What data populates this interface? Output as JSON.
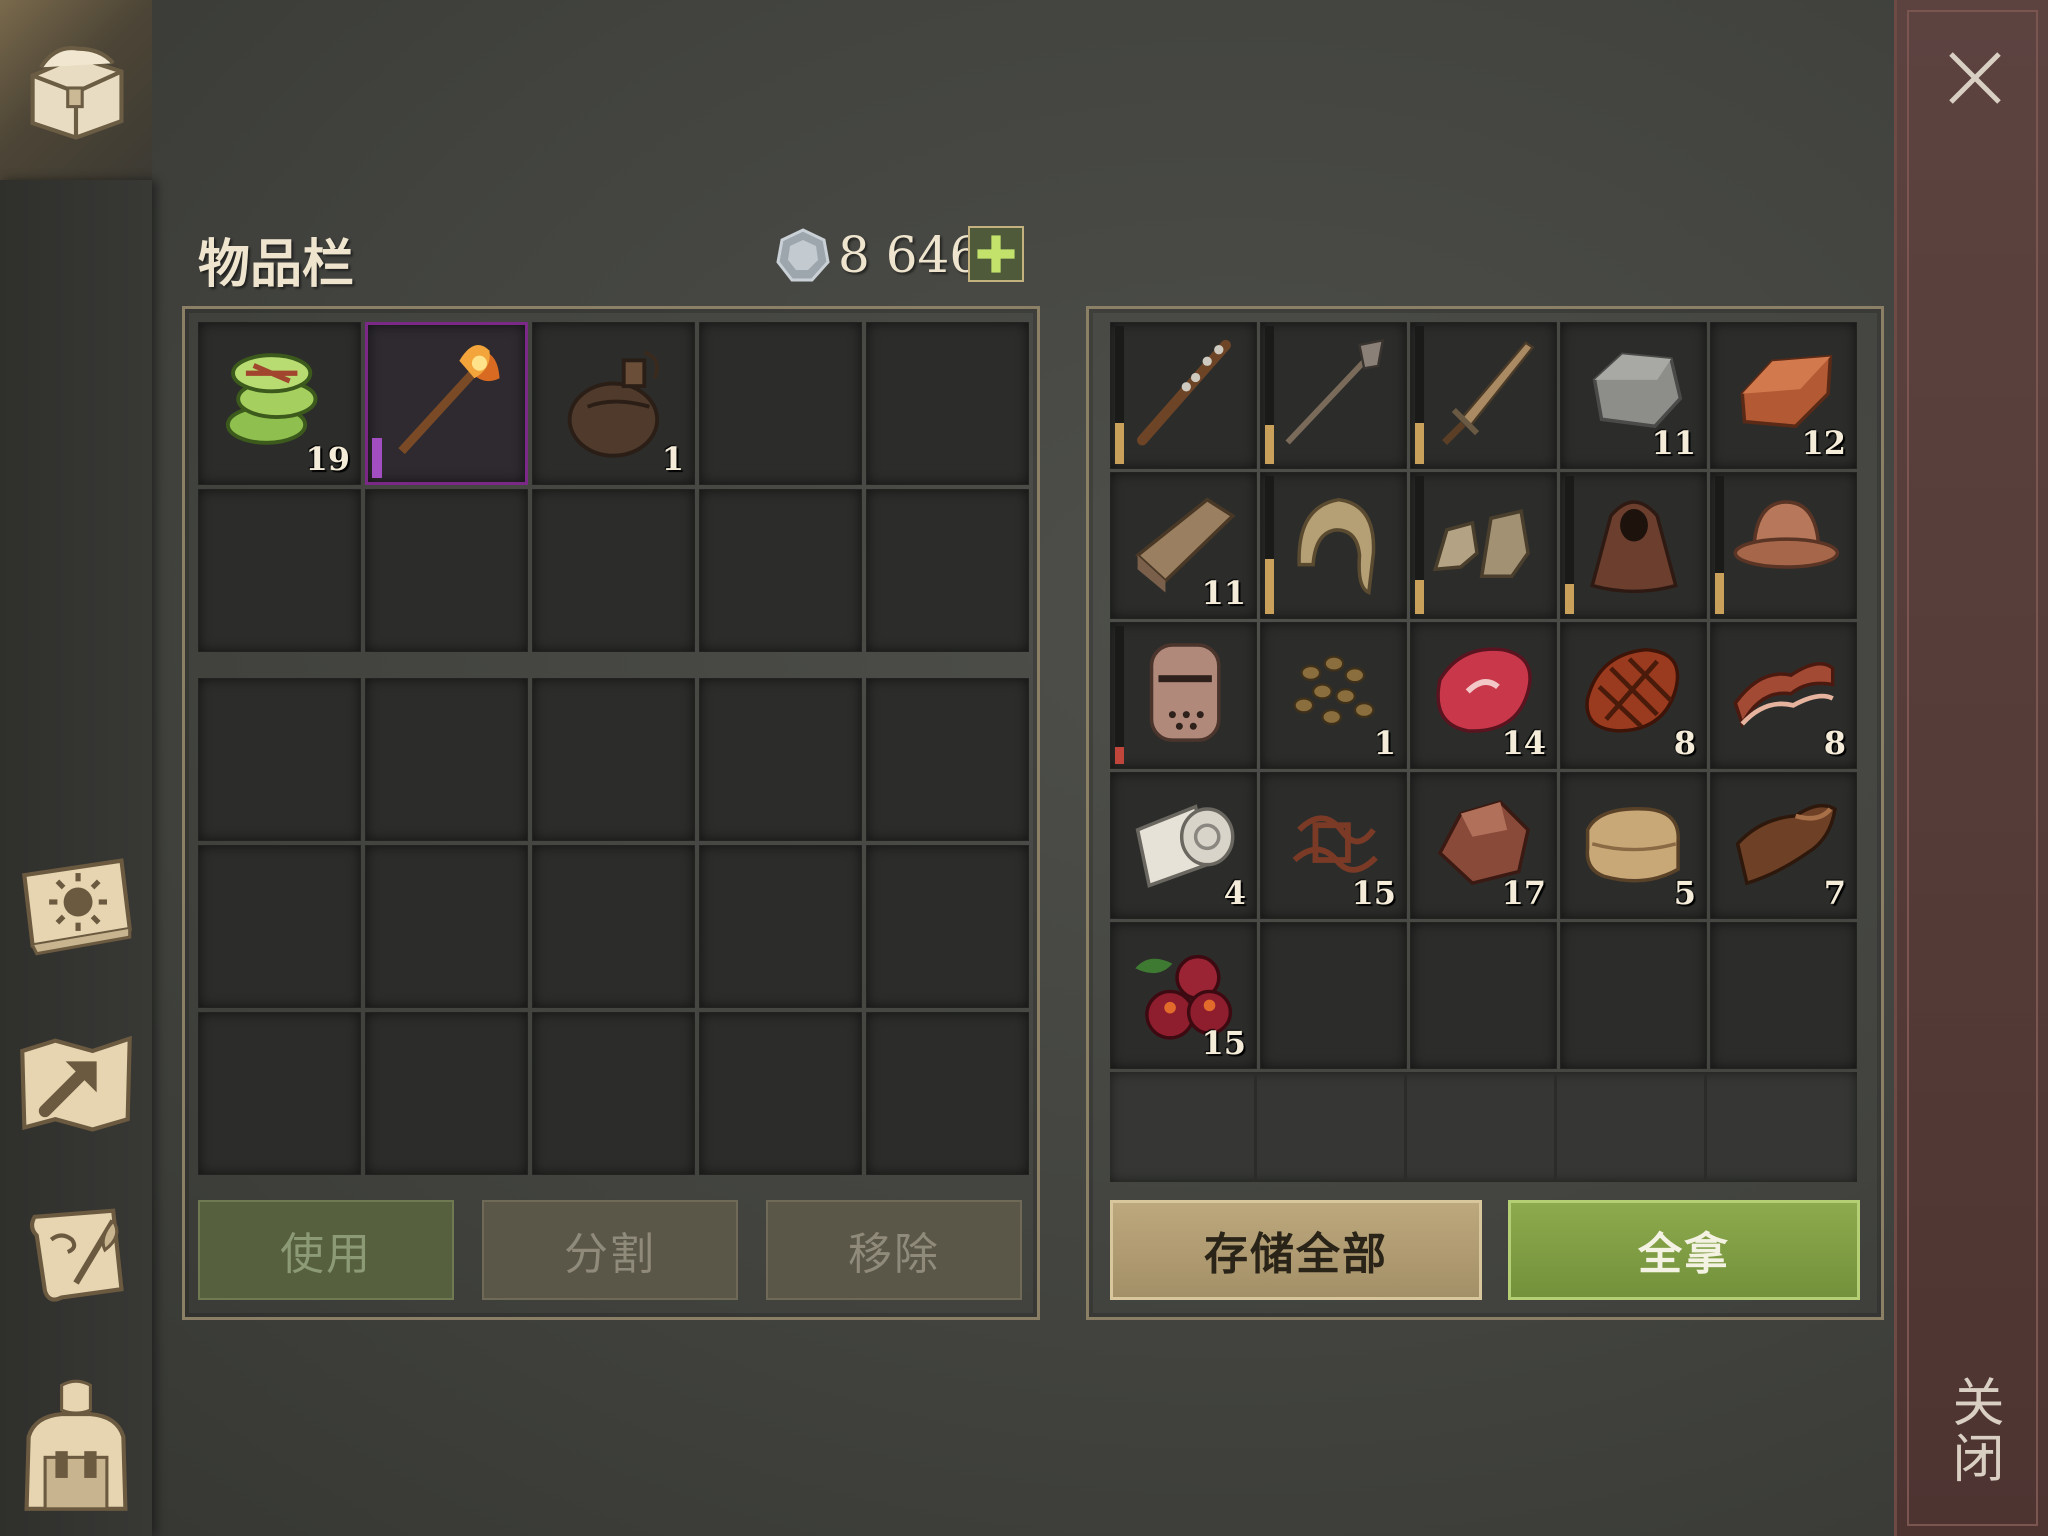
{
  "header": {
    "title": "物品栏",
    "currency": "8 646"
  },
  "sidebar": {
    "items": [
      "chest-icon",
      "daily-quest-book-icon",
      "map-icon",
      "scroll-quill-icon",
      "backpack-character-icon"
    ]
  },
  "close_panel": {
    "label": "关闭"
  },
  "inventory": {
    "slots": [
      {
        "icon": "cucumber-slices-icon",
        "count": "19"
      },
      {
        "icon": "flaming-axe-icon",
        "count": "",
        "selected": true
      },
      {
        "icon": "water-flask-icon",
        "count": "1"
      }
    ]
  },
  "container": {
    "slots": [
      {
        "icon": "spiked-club-icon",
        "count": ""
      },
      {
        "icon": "mace-spear-icon",
        "count": ""
      },
      {
        "icon": "sword-icon",
        "count": ""
      },
      {
        "icon": "stone-icon",
        "count": "11"
      },
      {
        "icon": "copper-ingot-icon",
        "count": "12"
      },
      {
        "icon": "wood-plank-icon",
        "count": "11"
      },
      {
        "icon": "hood-icon",
        "count": ""
      },
      {
        "icon": "boots-icon",
        "count": ""
      },
      {
        "icon": "cloak-hood-icon",
        "count": ""
      },
      {
        "icon": "kettle-helmet-icon",
        "count": ""
      },
      {
        "icon": "great-helm-icon",
        "count": ""
      },
      {
        "icon": "seeds-icon",
        "count": "1"
      },
      {
        "icon": "raw-meat-icon",
        "count": "14"
      },
      {
        "icon": "cooked-steak-icon",
        "count": "8"
      },
      {
        "icon": "bacon-icon",
        "count": "8"
      },
      {
        "icon": "bandage-roll-icon",
        "count": "4"
      },
      {
        "icon": "rope-scraps-icon",
        "count": "15"
      },
      {
        "icon": "copper-ore-icon",
        "count": "17"
      },
      {
        "icon": "cloth-icon",
        "count": "5"
      },
      {
        "icon": "leather-icon",
        "count": "7"
      },
      {
        "icon": "berries-icon",
        "count": "15"
      }
    ]
  },
  "buttons": {
    "use": "使用",
    "split": "分割",
    "remove": "移除",
    "store_all": "存储全部",
    "take_all": "全拿"
  },
  "colors": {
    "selected_border": "#7a2a86",
    "take_all_green": "#8eaa4e",
    "store_all_tan": "#bda87d",
    "durability_orange": "#c9a15a",
    "durability_red": "#c0453a"
  }
}
